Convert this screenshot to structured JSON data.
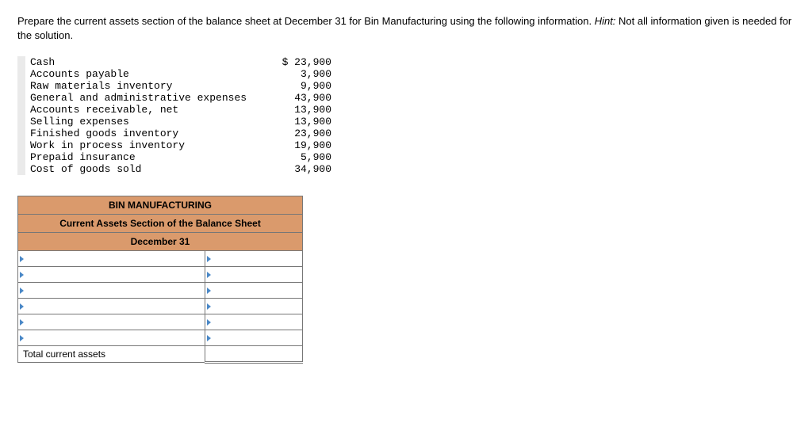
{
  "instructions": {
    "text_main": "Prepare the current assets section of the balance sheet at December 31 for Bin Manufacturing using the following information. ",
    "hint_label": "Hint:",
    "text_after_hint": " Not all information given is needed for the solution."
  },
  "given_data": {
    "currency_symbol": "$",
    "items": [
      {
        "label": "Cash",
        "value": "23,900",
        "first": true
      },
      {
        "label": "Accounts payable",
        "value": "3,900"
      },
      {
        "label": "Raw materials inventory",
        "value": "9,900"
      },
      {
        "label": "General and administrative expenses",
        "value": "43,900"
      },
      {
        "label": "Accounts receivable, net",
        "value": "13,900"
      },
      {
        "label": "Selling expenses",
        "value": "13,900"
      },
      {
        "label": "Finished goods inventory",
        "value": "23,900"
      },
      {
        "label": "Work in process inventory",
        "value": "19,900"
      },
      {
        "label": "Prepaid insurance",
        "value": "5,900"
      },
      {
        "label": "Cost of goods sold",
        "value": "34,900"
      }
    ]
  },
  "answer_table": {
    "header1": "BIN MANUFACTURING",
    "header2": "Current Assets Section of the Balance Sheet",
    "header3": "December 31",
    "total_label": "Total current assets",
    "input_rows": 6
  },
  "chart_data": {
    "type": "table",
    "title": "Given account balances",
    "categories": [
      "Cash",
      "Accounts payable",
      "Raw materials inventory",
      "General and administrative expenses",
      "Accounts receivable, net",
      "Selling expenses",
      "Finished goods inventory",
      "Work in process inventory",
      "Prepaid insurance",
      "Cost of goods sold"
    ],
    "values": [
      23900,
      3900,
      9900,
      43900,
      13900,
      13900,
      23900,
      19900,
      5900,
      34900
    ]
  }
}
